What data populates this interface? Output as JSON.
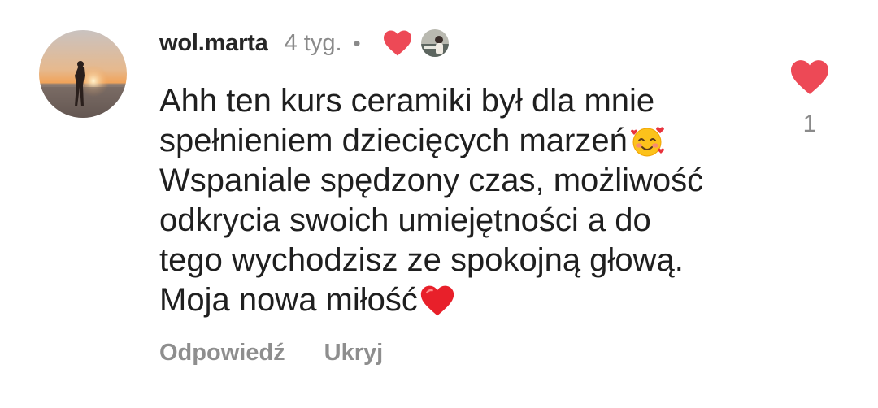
{
  "comment": {
    "username": "wol.marta",
    "time_ago": "4 tyg.",
    "separator": "•",
    "author_liked_icon": "heart-icon",
    "lines": [
      "Ahh ten kurs ceramiki był dla mnie",
      "spełnieniem dziecięcych marzeń",
      "Wspaniale spędzony czas, możliwość",
      "odkrycia swoich umiejętności a do",
      "tego wychodzisz ze spokojną głową.",
      "Moja nowa miłość"
    ],
    "emoji": {
      "line2_end": "smiling-face-with-hearts-emoji",
      "line6_end": "red-heart-emoji"
    },
    "actions": {
      "reply_label": "Odpowiedź",
      "hide_label": "Ukryj"
    },
    "likes": {
      "count": "1",
      "liked": true,
      "color": "#ed4956"
    }
  }
}
